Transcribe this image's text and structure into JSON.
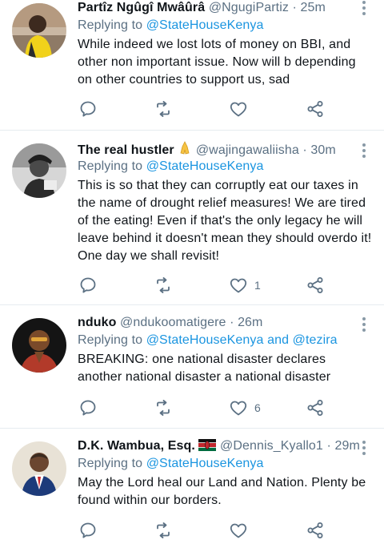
{
  "icons": {
    "reply": "reply-icon",
    "retweet": "retweet-icon",
    "like": "heart-icon",
    "share": "share-icon",
    "more": "more-vertical-icon"
  },
  "colors": {
    "link": "#1b95e0",
    "secondary_text": "#5b7083",
    "icon": "#5b7083",
    "divider": "#e6ecf0"
  },
  "tweets": [
    {
      "display_name": "Partîz Ngûgî Mwâûrâ",
      "handle": "@NgugiPartiz",
      "dot": "·",
      "time": "25m",
      "replying_prefix": "Replying to ",
      "replying_to": "@StateHouseKenya",
      "text": "While indeed we lost lots of money on BBI, and other non important issue. Now will b depending on other countries to support us, sad",
      "like_count": ""
    },
    {
      "display_name": "The real hustler",
      "name_emoji": "folded-hands-emoji",
      "handle": "@wajingawaliisha",
      "dot": "·",
      "time": "30m",
      "replying_prefix": "Replying to ",
      "replying_to": "@StateHouseKenya",
      "text": "This is so that they can corruptly eat our taxes in the name of drought relief measures! We are tired of the eating! Even if that's the only legacy he will leave behind it doesn't mean they should overdo it! One day we shall revisit!",
      "like_count": "1"
    },
    {
      "display_name": "nduko",
      "handle": "@ndukoomatigere",
      "dot": "·",
      "time": "26m",
      "replying_prefix": "Replying to ",
      "replying_to": "@StateHouseKenya and @tezira",
      "text": "BREAKING: one national disaster declares another national disaster a national disaster",
      "like_count": "6"
    },
    {
      "display_name": "D.K. Wambua, Esq.",
      "name_emoji": "kenya-flag-emoji",
      "handle": "@Dennis_Kyallo1",
      "dot": "·",
      "time": "29m",
      "replying_prefix": "Replying to ",
      "replying_to": "@StateHouseKenya",
      "text": "May the Lord heal our Land and Nation. Plenty be found within our borders.",
      "like_count": ""
    }
  ]
}
